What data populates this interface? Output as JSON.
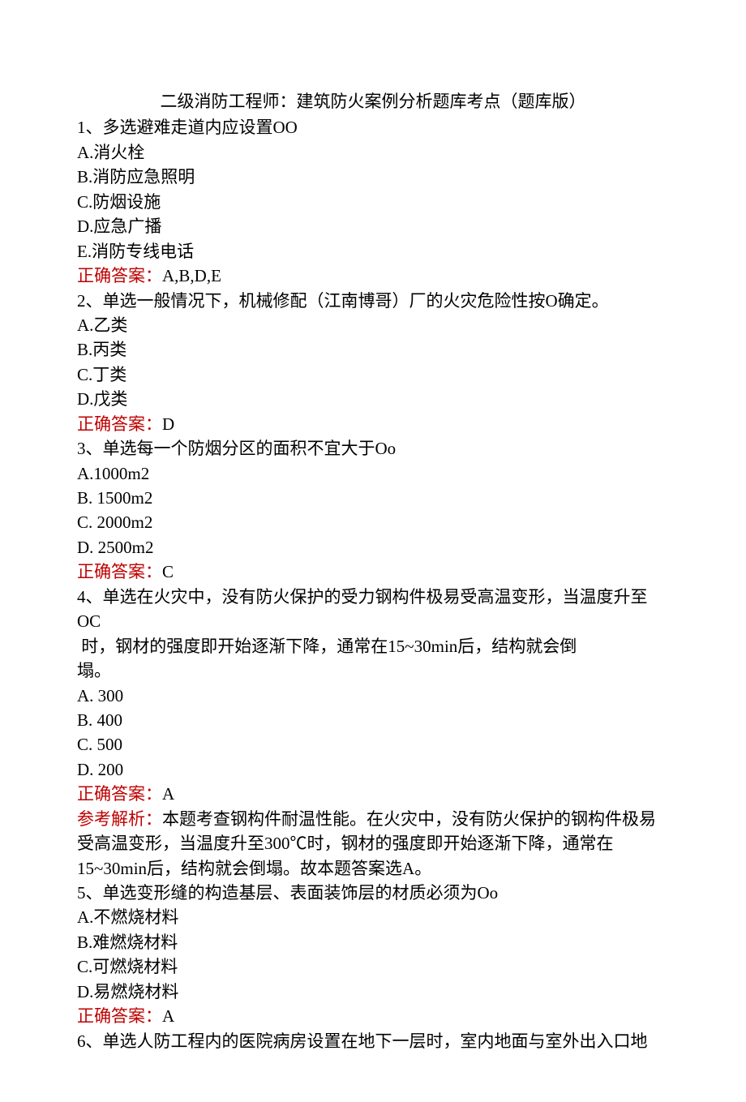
{
  "title": "二级消防工程师：建筑防火案例分析题库考点（题库版）",
  "q1": {
    "stem": "1、多选避难走道内应设置OO",
    "opts": [
      "A.消火栓",
      "B.消防应急照明",
      "C.防烟设施",
      "D.应急广播",
      "E.消防专线电话"
    ],
    "ans_label": "正确答案：",
    "ans_value": "A,B,D,E"
  },
  "q2": {
    "stem": "2、单选一般情况下，机械修配（江南博哥）厂的火灾危险性按O确定。",
    "opts": [
      "A.乙类",
      "B.丙类",
      "C.丁类",
      "D.戊类"
    ],
    "ans_label": "正确答案：",
    "ans_value": "D"
  },
  "q3": {
    "stem": "3、单选每一个防烟分区的面积不宜大于Oo",
    "opts": [
      "A.1000m2",
      "B. 1500m2",
      "C. 2000m2",
      "D. 2500m2"
    ],
    "ans_label": "正确答案：",
    "ans_value": "C"
  },
  "q4": {
    "stem1": "4、单选在火灾中，没有防火保护的受力钢构件极易受高温变形，当温度升至OC",
    "stem2": " 时，钢材的强度即开始逐渐下降，通常在15~30min后，结构就会倒",
    "stem3": "塌。",
    "opts": [
      "A. 300",
      "B. 400",
      "C. 500",
      "D. 200"
    ],
    "ans_label": "正确答案：",
    "ans_value": "A",
    "analysis_label": "参考解析：",
    "analysis_text1": "本题考查钢构件耐温性能。在火灾中，没有防火保护的钢构件极易",
    "analysis_text2": "受高温变形，当温度升至300℃时，钢材的强度即开始逐渐下降，通常在",
    "analysis_text3": "15~30min后，结构就会倒塌。故本题答案选A。"
  },
  "q5": {
    "stem": "5、单选变形缝的构造基层、表面装饰层的材质必须为Oo",
    "opts": [
      "A.不燃烧材料",
      "B.难燃烧材料",
      "C.可燃烧材料",
      "D.易燃烧材料"
    ],
    "ans_label": "正确答案：",
    "ans_value": "A"
  },
  "q6": {
    "stem": "6、单选人防工程内的医院病房设置在地下一层时，室内地面与室外出入口地"
  }
}
